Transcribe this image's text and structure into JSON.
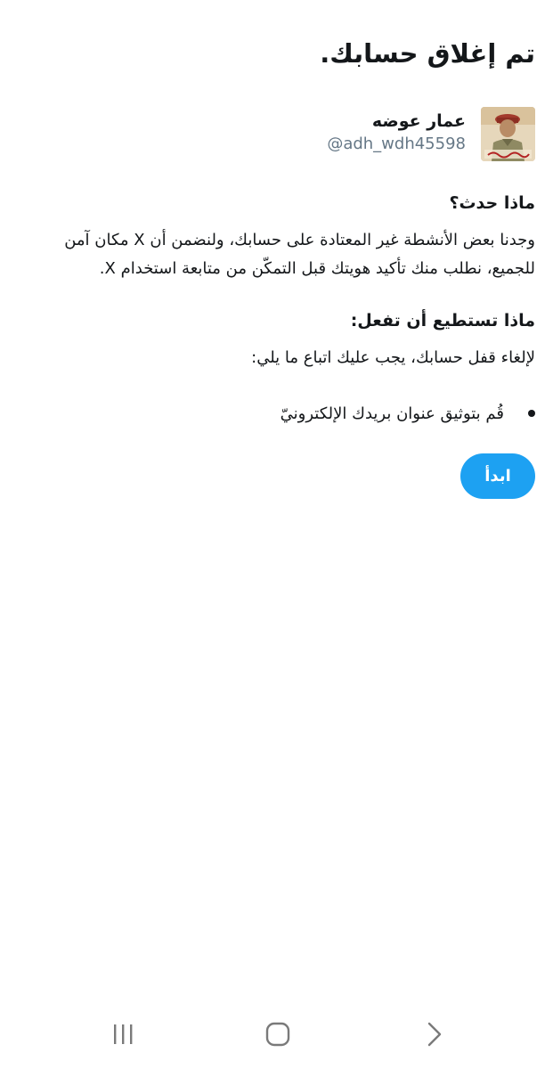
{
  "page": {
    "title": "تم إغلاق حسابك."
  },
  "account": {
    "display_name": "عمار عوضه",
    "handle": "@adh_wdh45598",
    "avatar_icon": "profile-photo-soldier"
  },
  "what_happened": {
    "heading": "ماذا حدث؟",
    "body": "وجدنا بعض الأنشطة غير المعتادة على حسابك، ولنضمن أن X مكان آمن للجميع، نطلب منك تأكيد هويتك قبل التمكّن من متابعة استخدام X."
  },
  "what_to_do": {
    "heading": "ماذا تستطيع أن تفعل:",
    "body": "لإلغاء قفل حسابك، يجب عليك اتباع ما يلي:",
    "steps": [
      "قُم بتوثيق عنوان بريدك الإلكترونيّ"
    ]
  },
  "actions": {
    "start_label": "ابدأ",
    "accent_color": "#1da1f2"
  },
  "navbar": {
    "recents_icon": "recent-apps-icon",
    "home_icon": "home-icon",
    "back_icon": "back-icon"
  }
}
